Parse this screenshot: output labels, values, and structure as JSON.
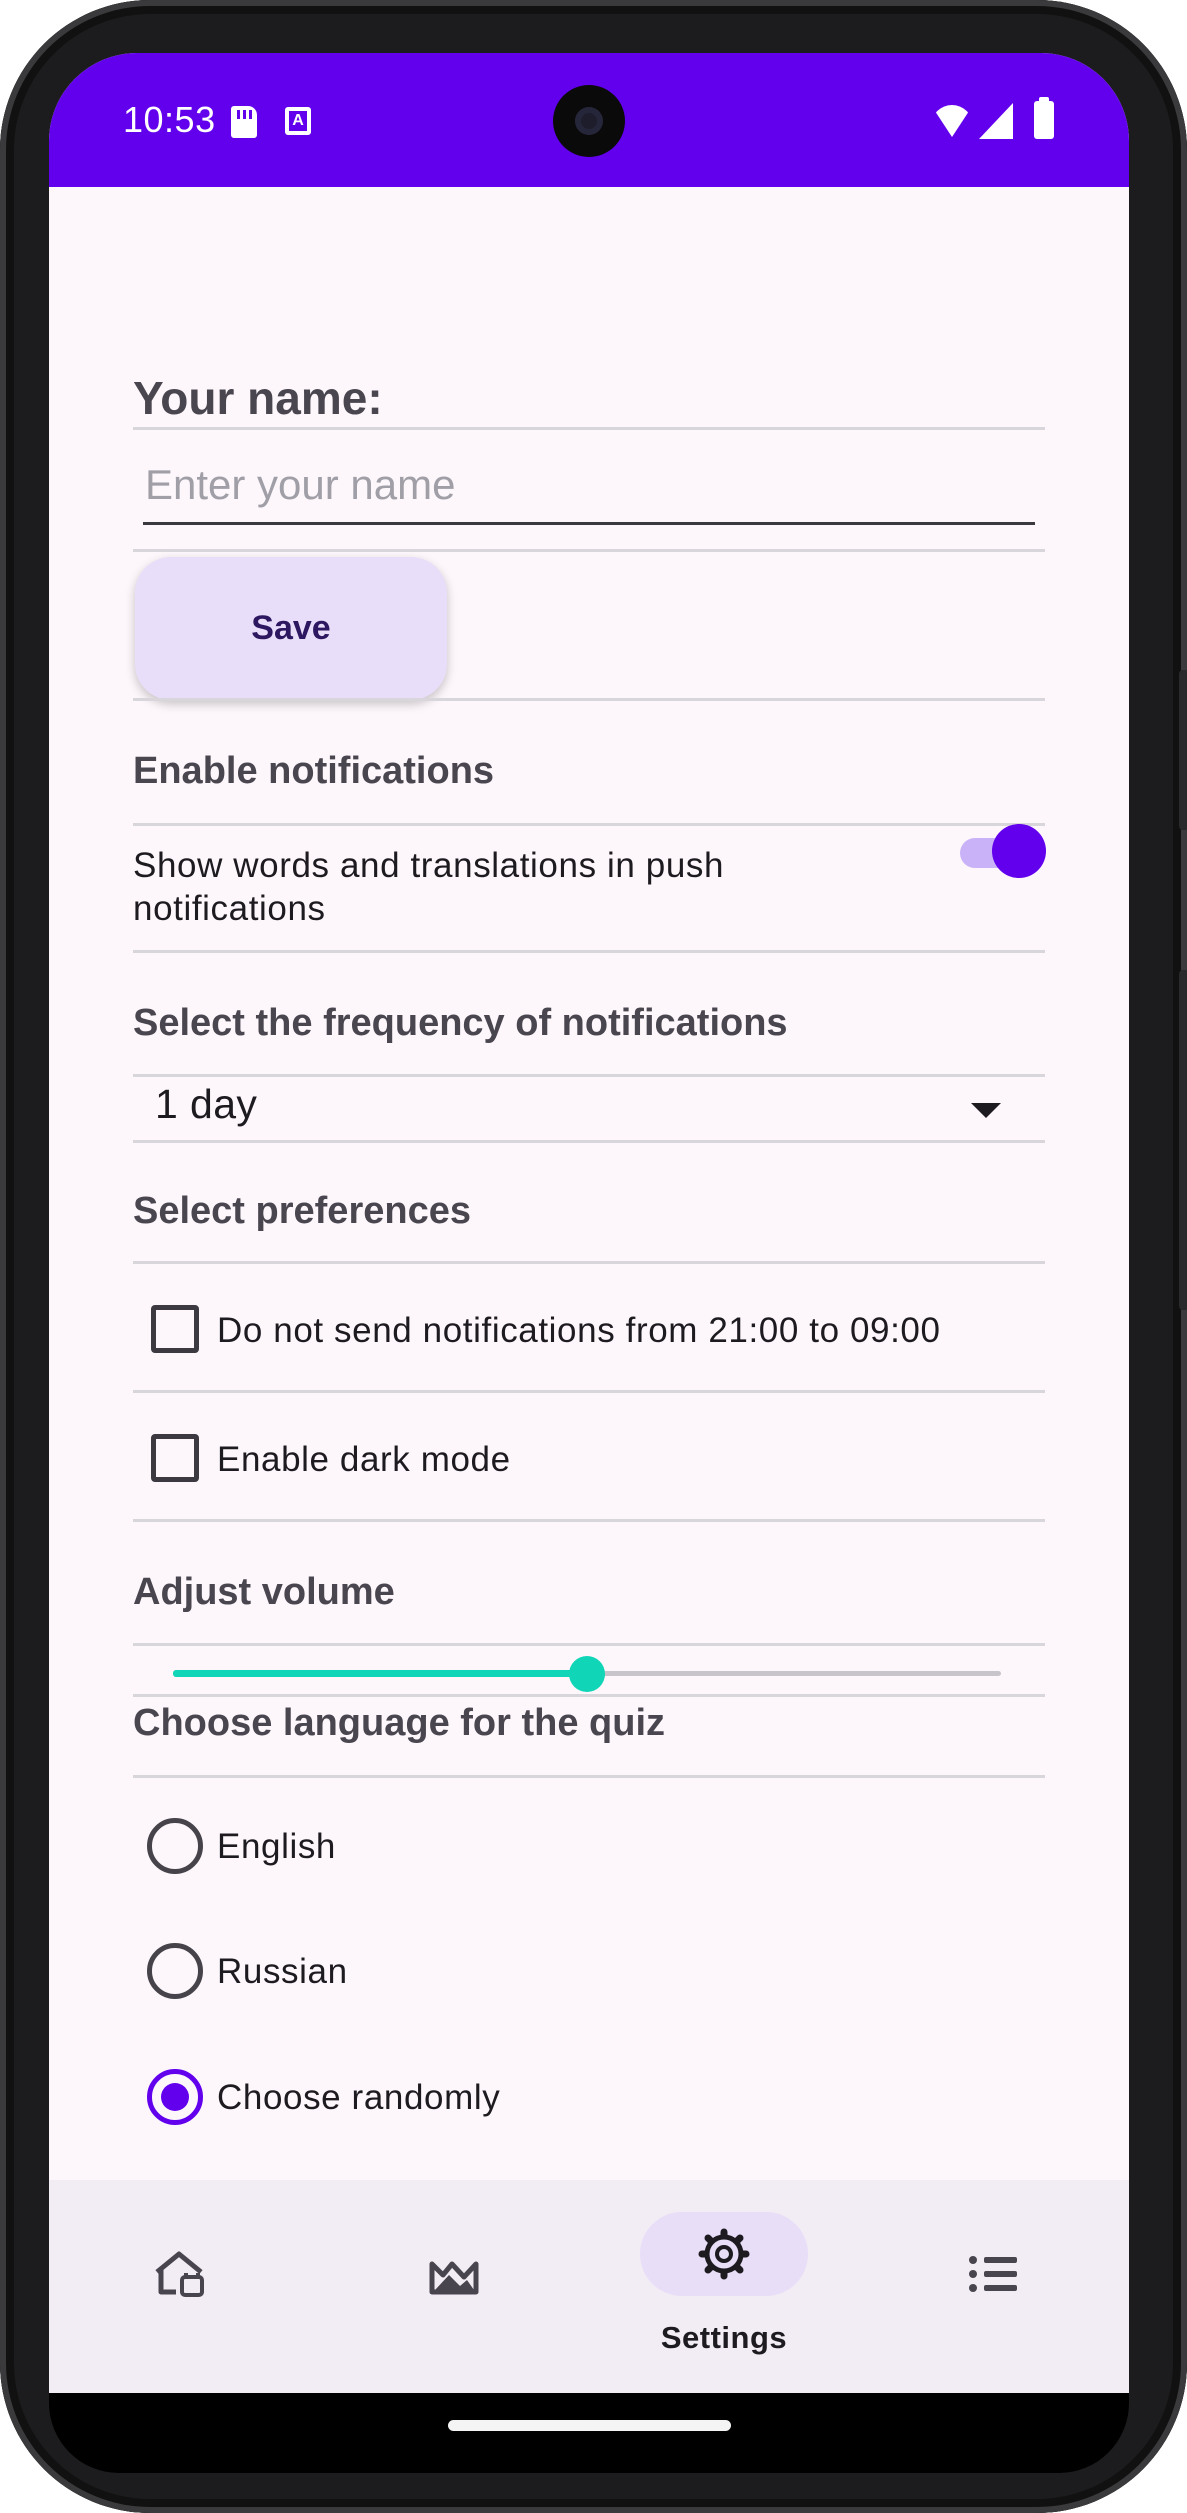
{
  "status_bar": {
    "time": "10:53"
  },
  "profile": {
    "name_label": "Your name:",
    "name_value": "",
    "name_placeholder": "Enter your name",
    "save_label": "Save"
  },
  "notifications": {
    "title": "Enable notifications",
    "push_label": "Show words and translations in push notifications",
    "push_enabled": true
  },
  "frequency": {
    "title": "Select the frequency of notifications",
    "selected": "1 day"
  },
  "preferences": {
    "title": "Select preferences",
    "options": [
      {
        "label": "Do not send notifications from 21:00 to 09:00",
        "checked": false
      },
      {
        "label": "Enable dark mode",
        "checked": false
      }
    ]
  },
  "volume": {
    "title": "Adjust volume",
    "value_fraction": 0.5
  },
  "quiz_language": {
    "title": "Choose language for the quiz",
    "options": [
      {
        "label": "English",
        "selected": false
      },
      {
        "label": "Russian",
        "selected": false
      },
      {
        "label": "Choose randomly",
        "selected": true
      }
    ]
  },
  "bottom_nav": {
    "items": [
      {
        "icon": "home-icon",
        "label": "",
        "active": false
      },
      {
        "icon": "landscape-icon",
        "label": "",
        "active": false
      },
      {
        "icon": "settings-icon",
        "label": "Settings",
        "active": true
      },
      {
        "icon": "list-icon",
        "label": "",
        "active": false
      }
    ]
  },
  "colors": {
    "primary": "#6200ee",
    "accent": "#10d5b7",
    "background": "#fdf7fb"
  }
}
